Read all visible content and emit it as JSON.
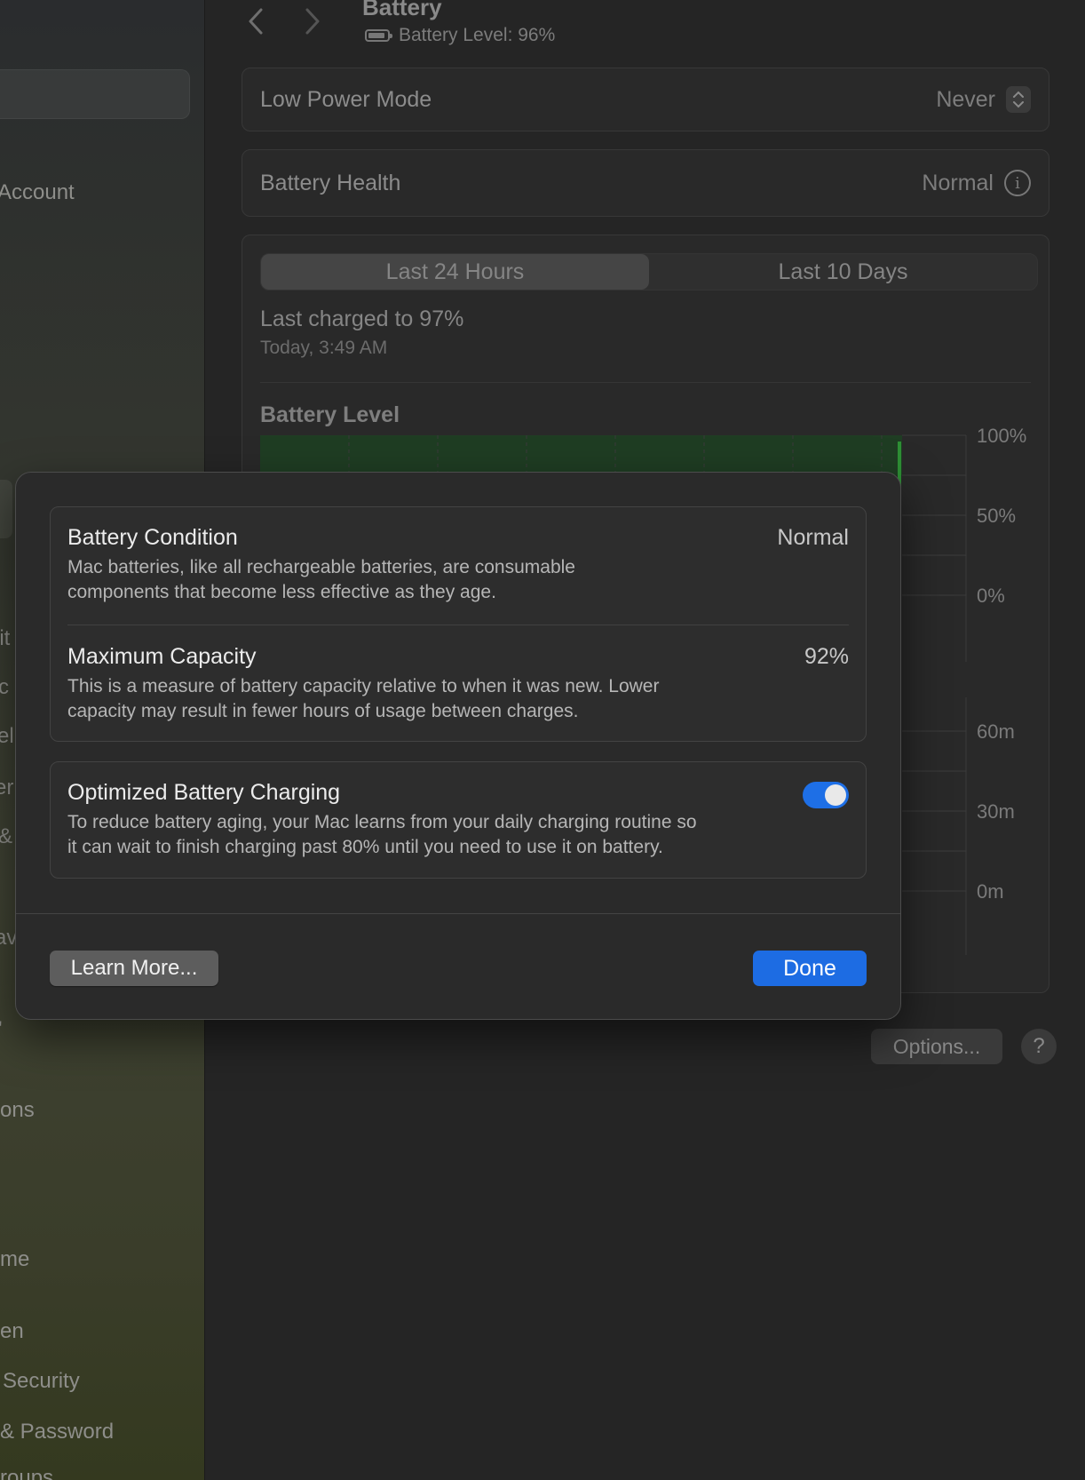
{
  "sidebar": {
    "items": [
      {
        "label": "Account"
      },
      {
        "label": "lit"
      },
      {
        "label": "c"
      },
      {
        "label": "ell"
      },
      {
        "label": "er"
      },
      {
        "label": "&"
      },
      {
        "label": "av"
      },
      {
        "label": "'"
      },
      {
        "label": "ons"
      },
      {
        "label": "me"
      },
      {
        "label": "en"
      },
      {
        "label": "Security"
      },
      {
        "label": "& Password"
      },
      {
        "label": "roups"
      }
    ]
  },
  "header": {
    "title": "Battery",
    "subtitle": "Battery Level: 96%"
  },
  "low_power": {
    "label": "Low Power Mode",
    "value": "Never"
  },
  "battery_health": {
    "label": "Battery Health",
    "value": "Normal"
  },
  "usage": {
    "tabs": [
      {
        "label": "Last 24 Hours",
        "active": true
      },
      {
        "label": "Last 10 Days",
        "active": false
      }
    ],
    "last_charged": "Last charged to 97%",
    "last_charged_time": "Today, 3:49 AM",
    "chart_title": "Battery Level"
  },
  "chart_data": [
    {
      "type": "area",
      "title": "Battery Level",
      "y_ticks": [
        "100%",
        "50%",
        "0%"
      ],
      "ylim": [
        0,
        100
      ],
      "color": "#2e7d32"
    },
    {
      "type": "bar",
      "title": "",
      "y_ticks": [
        "60m",
        "30m",
        "0m"
      ],
      "ylim": [
        0,
        60
      ]
    }
  ],
  "footer": {
    "options_label": "Options...",
    "help_label": "?"
  },
  "modal": {
    "condition": {
      "title": "Battery Condition",
      "value": "Normal",
      "description_line1": "Mac batteries, like all rechargeable batteries, are consumable",
      "description_line2": "components that become less effective as they age."
    },
    "capacity": {
      "title": "Maximum Capacity",
      "value": "92%",
      "description_line1": "This is a measure of battery capacity relative to when it was new. Lower",
      "description_line2": "capacity may result in fewer hours of usage between charges."
    },
    "optimized": {
      "title": "Optimized Battery Charging",
      "enabled": true,
      "description_line1": "To reduce battery aging, your Mac learns from your daily charging routine so",
      "description_line2": "it can wait to finish charging past 80% until you need to use it on battery."
    },
    "learn_more_label": "Learn More...",
    "done_label": "Done",
    "accent_color": "#1d6ce3"
  }
}
